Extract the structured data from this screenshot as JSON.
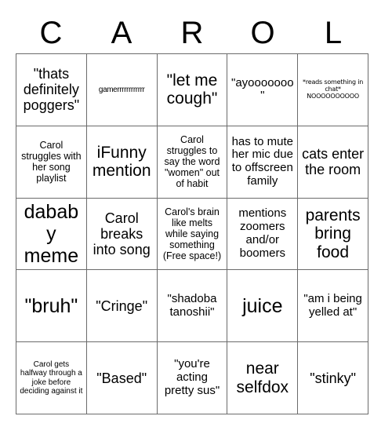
{
  "header": {
    "letters": [
      "C",
      "A",
      "R",
      "O",
      "L"
    ]
  },
  "grid": {
    "rows": 5,
    "columns": 5,
    "border_color": "#6b6b6b",
    "background": "#ffffff",
    "text_color": "#000000"
  },
  "cells": [
    {
      "text": "\"thats definitely poggers\"",
      "size": "lg"
    },
    {
      "text": "gamerrrrrrrrrrrr",
      "size": "xs"
    },
    {
      "text": "\"let me cough\"",
      "size": "xl"
    },
    {
      "text": "\"ayooooooo\"",
      "size": "md"
    },
    {
      "text": "*reads something in chat*\nNOOOOOOOOOO",
      "size": "xxs"
    },
    {
      "text": "Carol struggles with her song playlist",
      "size": "sm"
    },
    {
      "text": "iFunny mention",
      "size": "xl"
    },
    {
      "text": "Carol struggles to say the word \"women\" out of habit",
      "size": "sm"
    },
    {
      "text": "has to mute her mic due to offscreen family",
      "size": "md"
    },
    {
      "text": "cats enter the room",
      "size": "lg"
    },
    {
      "text": "dababy meme",
      "size": "xxl"
    },
    {
      "text": "Carol breaks into song",
      "size": "lg"
    },
    {
      "text": "Carol's brain like melts while saying something (Free space!)",
      "size": "sm"
    },
    {
      "text": "mentions zoomers and/or boomers",
      "size": "md"
    },
    {
      "text": "parents bring food",
      "size": "xl"
    },
    {
      "text": "\"bruh\"",
      "size": "xxl"
    },
    {
      "text": "\"Cringe\"",
      "size": "lg"
    },
    {
      "text": "\"shadoba tanoshii\"",
      "size": "md"
    },
    {
      "text": "juice",
      "size": "xxl"
    },
    {
      "text": "\"am i being yelled at\"",
      "size": "md"
    },
    {
      "text": "Carol gets halfway through a joke before deciding against it",
      "size": "xs"
    },
    {
      "text": "\"Based\"",
      "size": "lg"
    },
    {
      "text": "\"you're acting pretty sus\"",
      "size": "md"
    },
    {
      "text": "near selfdox",
      "size": "xl"
    },
    {
      "text": "\"stinky\"",
      "size": "lg"
    }
  ]
}
